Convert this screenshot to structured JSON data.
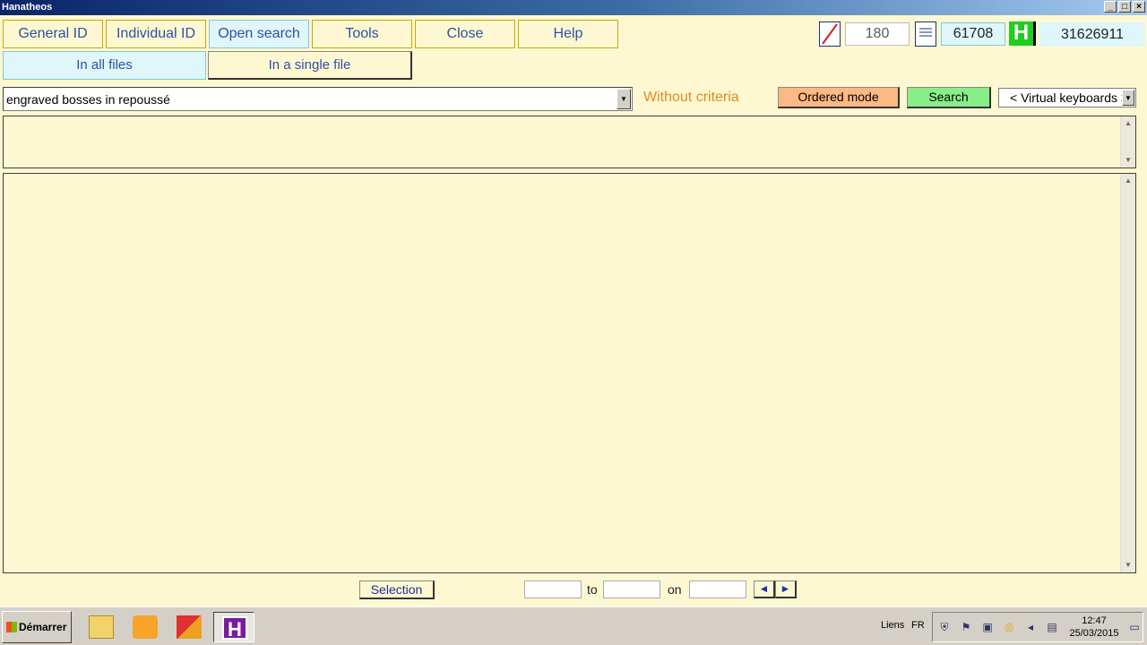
{
  "window": {
    "title": "Hanatheos",
    "controls": [
      "_",
      "□",
      "×"
    ]
  },
  "menu": {
    "general_id": "General ID",
    "individual_id": "Individual ID",
    "open_search": "Open search",
    "tools": "Tools",
    "close": "Close",
    "help": "Help"
  },
  "tabs": {
    "all_files": "In all files",
    "single_file": "In a single file"
  },
  "counters": {
    "first": "180",
    "second": "61708",
    "total": "31626911",
    "logo": "H"
  },
  "search": {
    "query": "engraved bosses in repoussé",
    "criteria": "Without criteria",
    "ordered_mode": "Ordered mode",
    "search": "Search",
    "virtual_keyboards": "< Virtual keyboards >"
  },
  "pagination": {
    "selection": "Selection",
    "to": "to",
    "on": "on",
    "prev": "◄",
    "next": "►"
  },
  "taskbar": {
    "start": "Démarrer",
    "links": "Liens",
    "lang": "FR",
    "time": "12:47",
    "date": "25/03/2015",
    "h_app": "H"
  }
}
